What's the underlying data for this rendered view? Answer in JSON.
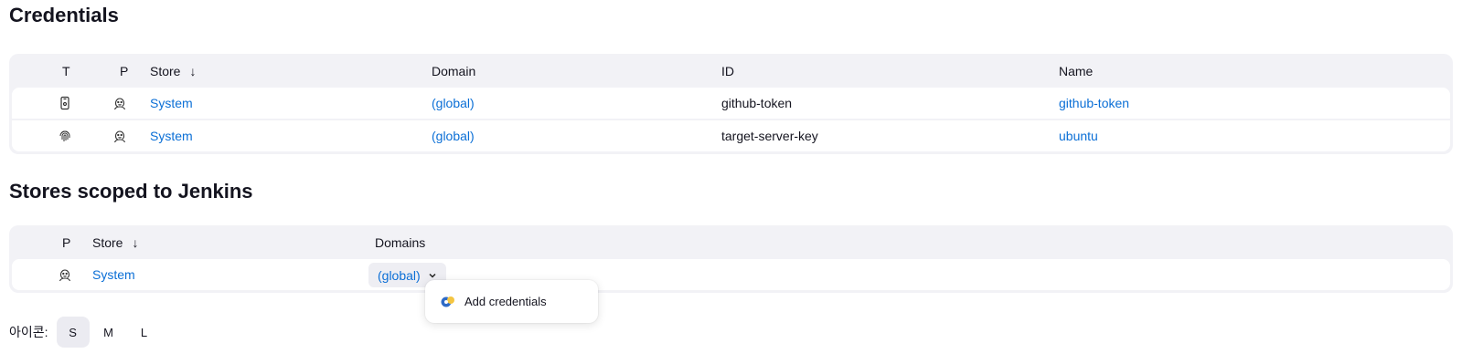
{
  "credentials": {
    "title": "Credentials",
    "headers": {
      "t": "T",
      "p": "P",
      "store": "Store",
      "sort": "↓",
      "domain": "Domain",
      "id": "ID",
      "name": "Name"
    },
    "rows": [
      {
        "type_icon": "mobile-key-icon",
        "provider_icon": "jenkins-head-icon",
        "store": "System",
        "domain": "(global)",
        "id": "github-token",
        "name": "github-token"
      },
      {
        "type_icon": "fingerprint-icon",
        "provider_icon": "jenkins-head-icon",
        "store": "System",
        "domain": "(global)",
        "id": "target-server-key",
        "name": "ubuntu"
      }
    ]
  },
  "stores": {
    "title": "Stores scoped to Jenkins",
    "headers": {
      "p": "P",
      "store": "Store",
      "sort": "↓",
      "domains": "Domains"
    },
    "rows": [
      {
        "provider_icon": "jenkins-head-icon",
        "store": "System",
        "domain": "(global)"
      }
    ]
  },
  "dropdown": {
    "items": [
      {
        "label": "Add credentials",
        "icon": "key-icon"
      }
    ]
  },
  "icon_size": {
    "label": "아이콘:",
    "options": [
      "S",
      "M",
      "L"
    ],
    "selected": "S"
  },
  "colors": {
    "link": "#0b6fd6",
    "table_bg": "#f2f2f6"
  }
}
